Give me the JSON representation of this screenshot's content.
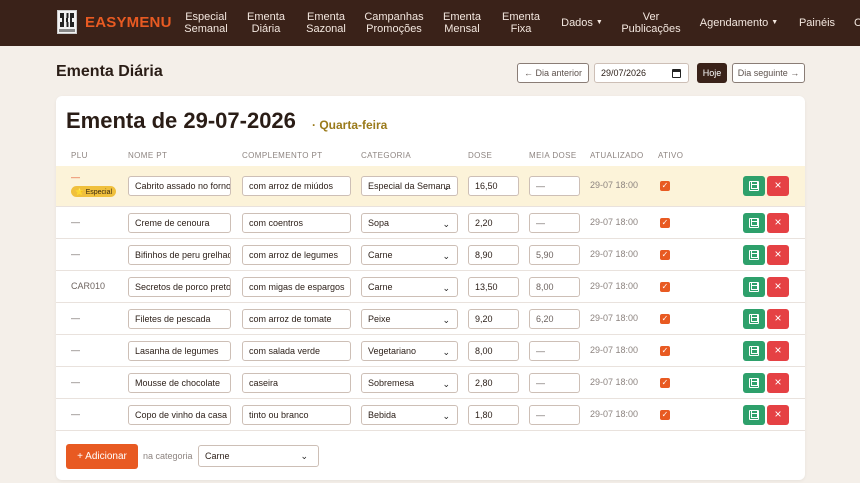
{
  "brand": {
    "name": "EASYMENU"
  },
  "nav": [
    {
      "label": "Especial Semanal"
    },
    {
      "label": "Ementa Diária"
    },
    {
      "label": "Ementa Sazonal"
    },
    {
      "label": "Campanhas Promoções"
    },
    {
      "label": "Ementa Mensal"
    },
    {
      "label": "Ementa Fixa"
    },
    {
      "label": "Dados",
      "dropdown": true
    },
    {
      "label": "Ver Publicações"
    },
    {
      "label": "Agendamento",
      "dropdown": true
    },
    {
      "label": "Painéis"
    },
    {
      "label": "C"
    }
  ],
  "header": {
    "title": "Ementa Diária",
    "prev_label": "← Dia anterior",
    "date_value": "29/07/2026",
    "today_label": "Hoje",
    "next_label": "Dia seguinte →"
  },
  "card": {
    "title": "Ementa de 29-07-2026",
    "weekday": "· Quarta-feira"
  },
  "columns": [
    "PLU",
    "NOME PT",
    "COMPLEMENTO PT",
    "CATEGORIA",
    "DOSE",
    "MEIA DOSE",
    "ATUALIZADO",
    "ATIVO"
  ],
  "rows": [
    {
      "plu": "—",
      "badge": "⭐ Especial",
      "name": "Cabrito assado no forno",
      "complement": "com arroz de miúdos",
      "category": "Especial da Semana",
      "dose": "16,50",
      "half": "—",
      "updated": "29-07 18:00",
      "highlight": true
    },
    {
      "plu": "—",
      "name": "Creme de cenoura",
      "complement": "com coentros",
      "category": "Sopa",
      "dose": "2,20",
      "half": "—",
      "updated": "29-07 18:00"
    },
    {
      "plu": "—",
      "name": "Bifinhos de peru grelhados",
      "complement": "com arroz de legumes",
      "category": "Carne",
      "dose": "8,90",
      "half": "5,90",
      "updated": "29-07 18:00"
    },
    {
      "plu": "CAR010",
      "name": "Secretos de porco preto",
      "complement": "com migas de espargos",
      "category": "Carne",
      "dose": "13,50",
      "half": "8,00",
      "updated": "29-07 18:00"
    },
    {
      "plu": "—",
      "name": "Filetes de pescada",
      "complement": "com arroz de tomate",
      "category": "Peixe",
      "dose": "9,20",
      "half": "6,20",
      "updated": "29-07 18:00"
    },
    {
      "plu": "—",
      "name": "Lasanha de legumes",
      "complement": "com salada verde",
      "category": "Vegetariano",
      "dose": "8,00",
      "half": "—",
      "updated": "29-07 18:00"
    },
    {
      "plu": "—",
      "name": "Mousse de chocolate",
      "complement": "caseira",
      "category": "Sobremesa",
      "dose": "2,80",
      "half": "—",
      "updated": "29-07 18:00"
    },
    {
      "plu": "—",
      "name": "Copo de vinho da casa",
      "complement": "tinto ou branco",
      "category": "Bebida",
      "dose": "1,80",
      "half": "—",
      "updated": "29-07 18:00"
    }
  ],
  "footer": {
    "add_label": "+ Adicionar",
    "in_category": "na categoria",
    "category_value": "Carne"
  },
  "colors": {
    "navbar": "#3a2219",
    "accent": "#e85a22",
    "save": "#2ea06b",
    "delete": "#e54144",
    "highlight": "#fcf3d9",
    "badge": "#f0c03d"
  },
  "icons": {
    "save": "floppy-disk-icon",
    "delete": "close-icon",
    "active": "checkbox-checked-icon",
    "calendar": "calendar-icon",
    "select": "chevron-down-icon"
  }
}
